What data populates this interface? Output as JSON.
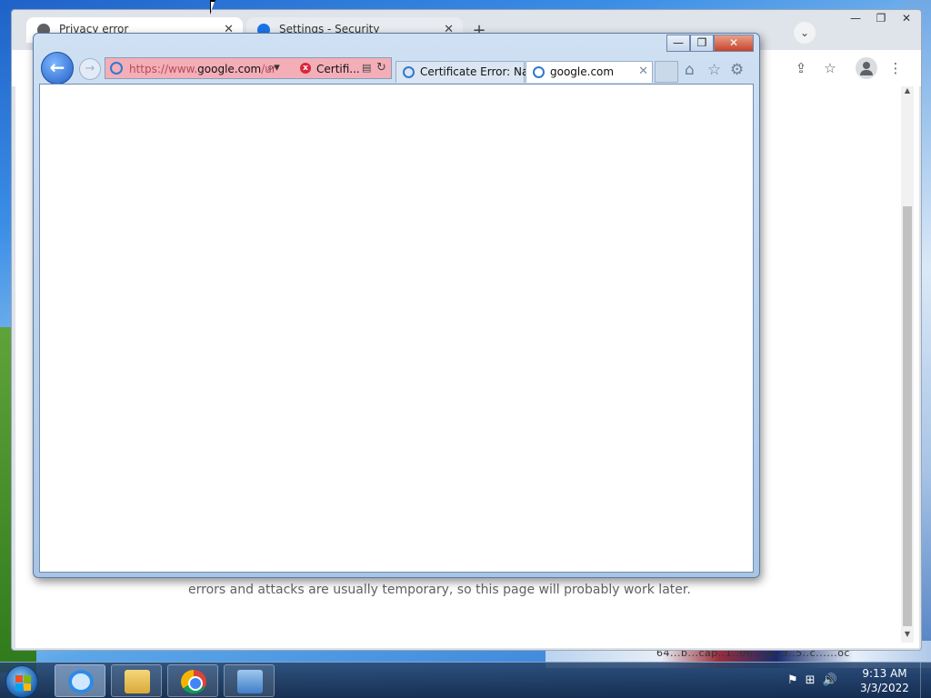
{
  "chrome": {
    "tabs": [
      {
        "label": "Privacy error"
      },
      {
        "label": "Settings - Security"
      }
    ],
    "tab_close": "✕",
    "new_tab": "+",
    "tab_search": "⌄",
    "win_minimize": "—",
    "win_restore": "❐",
    "win_close": "✕",
    "body_text": "errors and attacks are usually temporary, so this page will probably work later.",
    "share_icon": "⇪",
    "star_icon": "☆",
    "menu_icon": "⋮"
  },
  "ie": {
    "minimize": "—",
    "maximize": "❐",
    "close": "✕",
    "back": "←",
    "forward": "→",
    "address": {
      "url_prefix": "https://www.",
      "url_domain": "google.com",
      "url_suffix": "/ur",
      "search_glyph": "⌕▾",
      "cert_label": "Certifi...",
      "compat_glyph": "▤",
      "refresh_glyph": "↻"
    },
    "tabs": [
      {
        "label": "Certificate Error: Na..."
      },
      {
        "label": "google.com",
        "close": "✕"
      }
    ],
    "home_icon": "⌂",
    "favorites_icon": "☆",
    "tools_icon": "⚙"
  },
  "taskbar": {
    "tray_flag": "⚑",
    "tray_network": "⊞",
    "tray_volume": "🔊",
    "time": "9:13 AM",
    "date": "3/3/2022"
  },
  "wallpaper_text": "64...b...cap..1..06....0..3..5..c......oc"
}
